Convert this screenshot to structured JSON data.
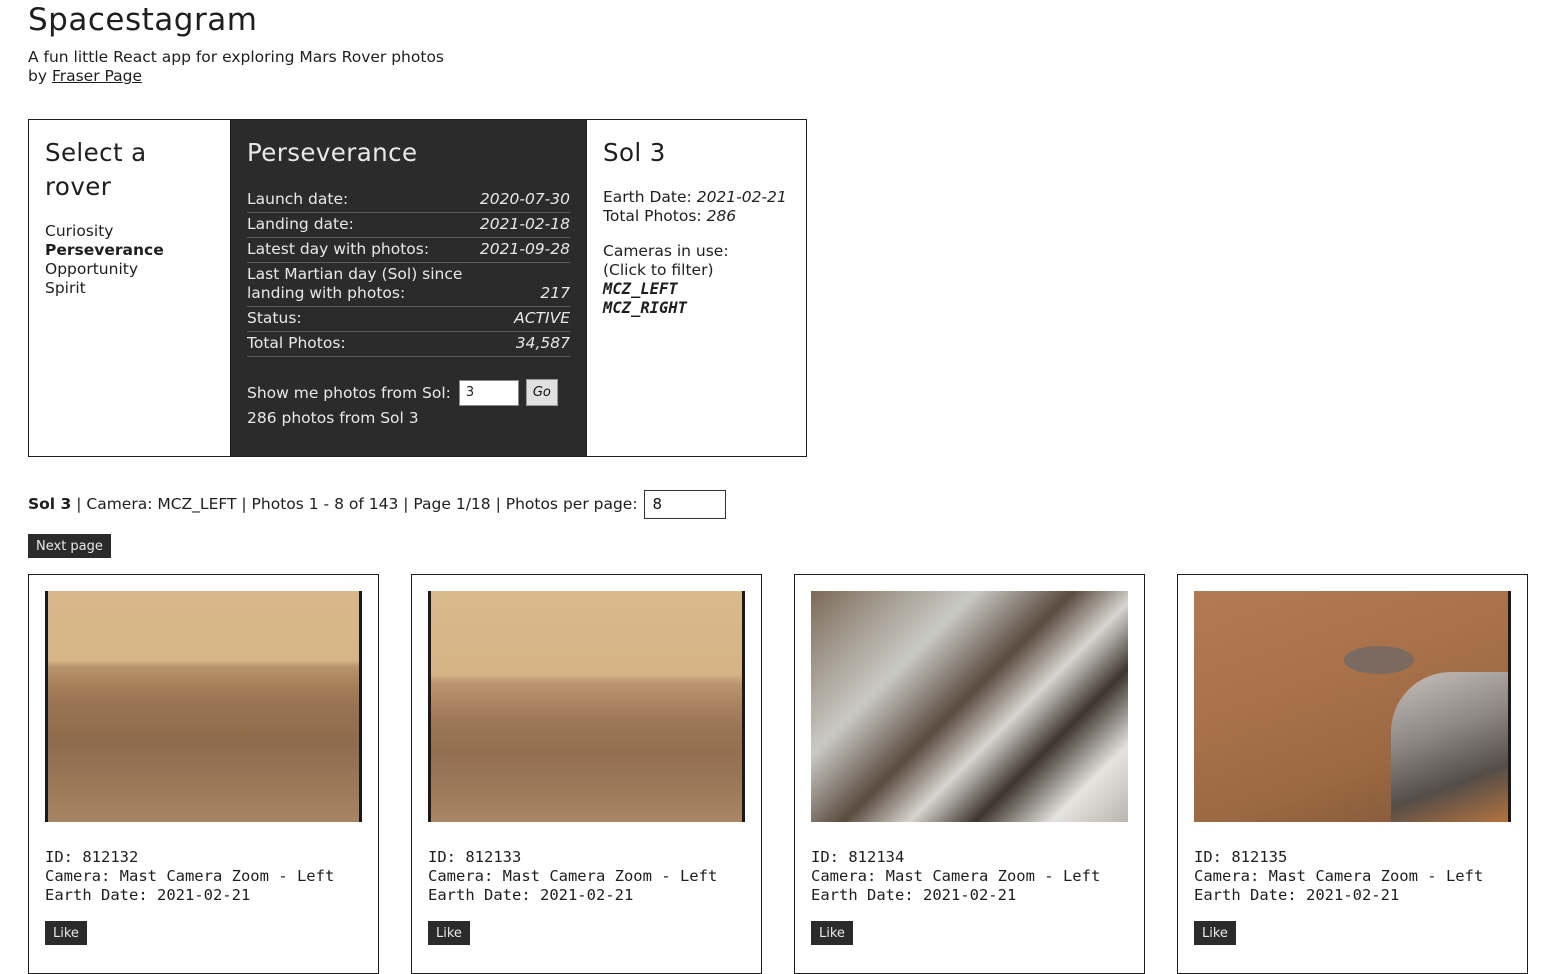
{
  "app": {
    "title": "Spacestagram",
    "subtitle": "A fun little React app for exploring Mars Rover photos",
    "by_prefix": "by",
    "author": "Fraser Page"
  },
  "rover_select": {
    "heading": "Select a rover",
    "rovers": [
      "Curiosity",
      "Perseverance",
      "Opportunity",
      "Spirit"
    ],
    "selected": "Perseverance"
  },
  "rover_details": {
    "name": "Perseverance",
    "rows": [
      {
        "label": "Launch date:",
        "value": "2020-07-30"
      },
      {
        "label": "Landing date:",
        "value": "2021-02-18"
      },
      {
        "label": "Latest day with photos:",
        "value": "2021-09-28"
      },
      {
        "label": "Last Martian day (Sol) since landing with photos:",
        "value": "217"
      },
      {
        "label": "Status:",
        "value": "ACTIVE"
      },
      {
        "label": "Total Photos:",
        "value": "34,587"
      }
    ],
    "sol_prompt": "Show me photos from Sol:",
    "sol_input_value": "3",
    "go_label": "Go",
    "sol_count_text": "286 photos from Sol 3"
  },
  "sol_panel": {
    "heading": "Sol 3",
    "earth_date_label": "Earth Date:",
    "earth_date": "2021-02-21",
    "total_photos_label": "Total Photos:",
    "total_photos": "286",
    "cameras_label": "Cameras in use:",
    "cameras_hint": "(Click to filter)",
    "cameras": [
      "MCZ_LEFT",
      "MCZ_RIGHT"
    ]
  },
  "status_bar": {
    "sol": "Sol 3",
    "rest": " | Camera: MCZ_LEFT | Photos 1 - 8 of 143 | Page 1/18 | Photos per page:",
    "per_page_value": "8"
  },
  "next_page_label": "Next page",
  "photos": [
    {
      "id_line": "ID: 812132",
      "camera_line": "Camera: Mast Camera Zoom - Left",
      "date_line": "Earth Date: 2021-02-21",
      "like_label": "Like"
    },
    {
      "id_line": "ID: 812133",
      "camera_line": "Camera: Mast Camera Zoom - Left",
      "date_line": "Earth Date: 2021-02-21",
      "like_label": "Like"
    },
    {
      "id_line": "ID: 812134",
      "camera_line": "Camera: Mast Camera Zoom - Left",
      "date_line": "Earth Date: 2021-02-21",
      "like_label": "Like"
    },
    {
      "id_line": "ID: 812135",
      "camera_line": "Camera: Mast Camera Zoom - Left",
      "date_line": "Earth Date: 2021-02-21",
      "like_label": "Like"
    }
  ]
}
